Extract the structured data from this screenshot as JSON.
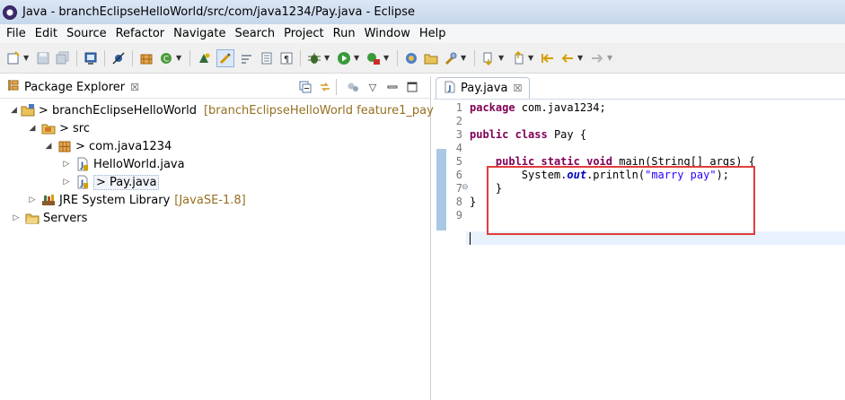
{
  "window": {
    "title": "Java - branchEclipseHelloWorld/src/com/java1234/Pay.java - Eclipse"
  },
  "menubar": [
    "File",
    "Edit",
    "Source",
    "Refactor",
    "Navigate",
    "Search",
    "Project",
    "Run",
    "Window",
    "Help"
  ],
  "explorer": {
    "tab_label": "Package Explorer",
    "close_glyph": "☒",
    "tree": [
      {
        "level": 0,
        "twisty": "◢",
        "icon": "project-icon",
        "label": "> branchEclipseHelloWorld",
        "decoration": "[branchEclipseHelloWorld feature1_pay]"
      },
      {
        "level": 1,
        "twisty": "◢",
        "icon": "source-folder-icon",
        "label": "> src",
        "decoration": ""
      },
      {
        "level": 2,
        "twisty": "◢",
        "icon": "package-icon",
        "label": "> com.java1234",
        "decoration": ""
      },
      {
        "level": 3,
        "twisty": "▷",
        "icon": "java-file-icon",
        "label": "HelloWorld.java",
        "decoration": ""
      },
      {
        "level": 3,
        "twisty": "▷",
        "icon": "java-file-icon",
        "label": "> Pay.java",
        "decoration": "",
        "selected": true
      },
      {
        "level": 1,
        "twisty": "▷",
        "icon": "library-icon",
        "label": "JRE System Library",
        "decoration": "[JavaSE-1.8]"
      },
      {
        "level": 0,
        "twisty": "▷",
        "icon": "servers-folder-icon",
        "label": "Servers",
        "decoration": ""
      }
    ]
  },
  "editor": {
    "tab_label": "Pay.java",
    "close_glyph": "☒",
    "line_numbers": [
      "1",
      "2",
      "3",
      "4",
      "5",
      "6",
      "7",
      "8",
      "9"
    ],
    "fold_marker_line": "5",
    "code": {
      "l1_kw": "package",
      "l1_rest": " com.java1234;",
      "l3_kw1": "public",
      "l3_kw2": "class",
      "l3_rest": " Pay {",
      "l5_indent": "    ",
      "l5_kw1": "public",
      "l5_kw2": "static",
      "l5_kw3": "void",
      "l5_rest": " main(String[] args) {",
      "l6_indent": "        System.",
      "l6_field": "out",
      "l6_mid": ".println(",
      "l6_str": "\"marry pay\"",
      "l6_end": ");",
      "l7": "    }",
      "l8": "}"
    }
  },
  "colors": {
    "keyword": "#7f0055",
    "string": "#2a00ff",
    "field": "#0000c0",
    "highlight_border": "#e33c3c",
    "decoration": "#956f1f"
  }
}
